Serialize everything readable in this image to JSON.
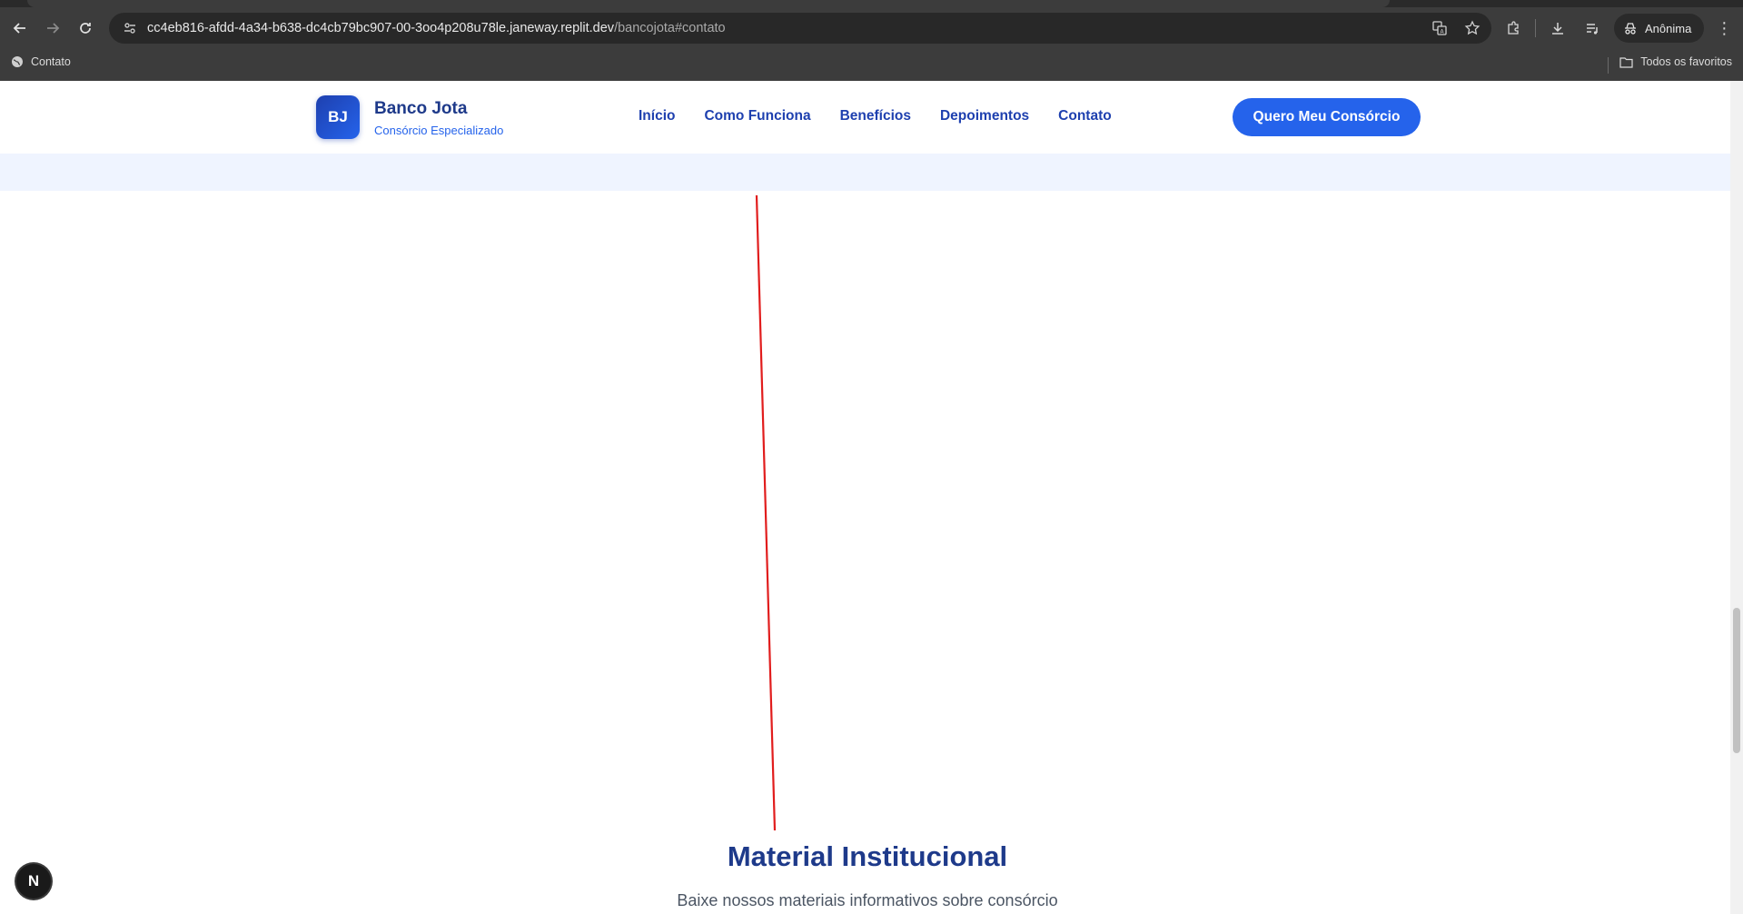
{
  "browser": {
    "url_host": "cc4eb816-afdd-4a34-b638-dc4cb79bc907-00-3oo4p208u78le.janeway.replit.dev",
    "url_path": "/bancojota#contato",
    "incognito_label": "Anônima",
    "bookmark_item": "Contato",
    "bookmarks_folder": "Todos os favoritos"
  },
  "header": {
    "logo_initials": "BJ",
    "brand_name": "Banco Jota",
    "brand_subtitle": "Consórcio Especializado",
    "nav": [
      {
        "label": "Início"
      },
      {
        "label": "Como Funciona"
      },
      {
        "label": "Benefícios"
      },
      {
        "label": "Depoimentos"
      },
      {
        "label": "Contato"
      }
    ],
    "cta_label": "Quero Meu Consórcio"
  },
  "section": {
    "title": "Material Institucional",
    "subtitle": "Baixe nossos materiais informativos sobre consórcio"
  },
  "badge": {
    "letter": "N"
  },
  "colors": {
    "brand_dark": "#1e3a8a",
    "brand_primary": "#2563eb",
    "annotation_line": "#e11d1d"
  }
}
